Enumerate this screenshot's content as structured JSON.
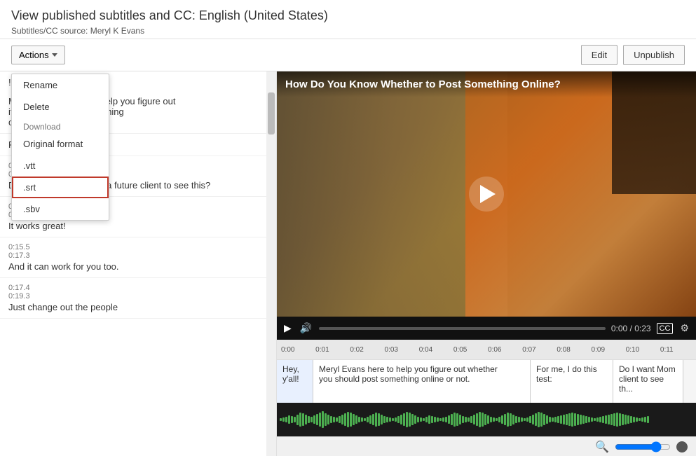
{
  "header": {
    "title": "View published subtitles and CC: English (United States)",
    "source_label": "Subtitles/CC source: Meryl K Evans"
  },
  "toolbar": {
    "actions_label": "Actions",
    "edit_label": "Edit",
    "unpublish_label": "Unpublish"
  },
  "dropdown": {
    "rename": "Rename",
    "delete": "Delete",
    "download_label": "Download",
    "original_format": "Original format",
    "vtt": ".vtt",
    "srt": ".srt",
    "sbv": ".sbv"
  },
  "subtitles": [
    {
      "id": 1,
      "time_start": "",
      "time_end": "",
      "text": "!"
    },
    {
      "id": 2,
      "time_start": "",
      "time_end": "",
      "text": "Meryl K Evans here to help you figure out\nif you should post something\nonline or not."
    },
    {
      "id": 3,
      "time_start": "",
      "time_end": "",
      "text": "For me, I do this test:"
    },
    {
      "id": 4,
      "time_start": "0:09.6",
      "time_end": "0:13.9",
      "text": "Do I want Mom, kids, or a future client to\nsee this?"
    },
    {
      "id": 5,
      "time_start": "0:13.9",
      "time_end": "0:15.5",
      "text": "It works great!"
    },
    {
      "id": 6,
      "time_start": "0:15.5",
      "time_end": "0:17.3",
      "text": "And it can work for you too."
    },
    {
      "id": 7,
      "time_start": "0:17.4",
      "time_end": "0:19.3",
      "text": "Just change out the people"
    }
  ],
  "video": {
    "title": "How Do You Know Whether to Post Something Online?",
    "time_current": "0:00",
    "time_total": "0:23"
  },
  "timeline": {
    "labels": [
      "0:01",
      "0:02",
      "0:03",
      "0:04",
      "0:05",
      "0:06",
      "0:07",
      "0:08",
      "0:09",
      "0:10",
      "0:11"
    ]
  },
  "captions": [
    {
      "id": "hey",
      "text": "Hey,\ny'all!"
    },
    {
      "id": "meryl",
      "text": "Meryl Evans here to help you figure out whether\nyou should post something online or not."
    },
    {
      "id": "forme",
      "text": "For me, I do this\ntest:"
    },
    {
      "id": "doiwant",
      "text": "Do I want Mom\nclient to see th..."
    }
  ]
}
